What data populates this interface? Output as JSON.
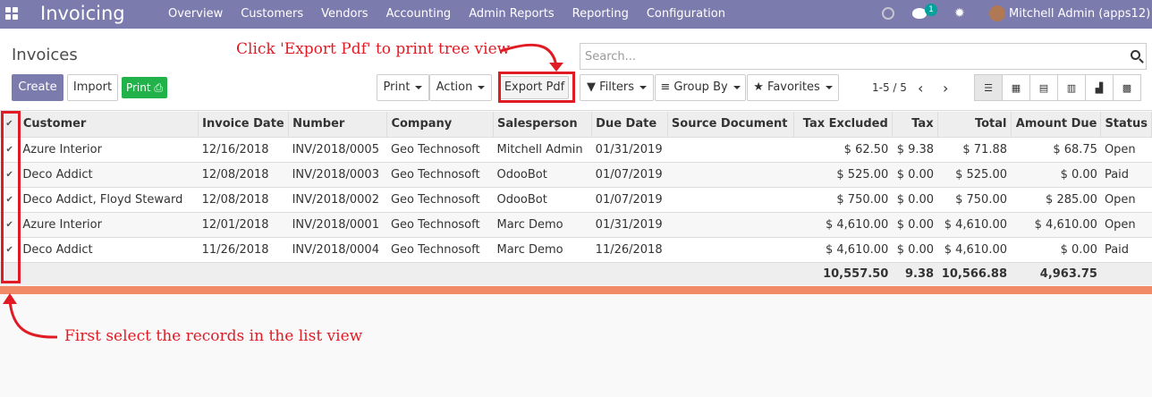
{
  "nav": {
    "brand": "Invoicing",
    "menu": [
      "Overview",
      "Customers",
      "Vendors",
      "Accounting",
      "Admin Reports",
      "Reporting",
      "Configuration"
    ],
    "chat_count": "1",
    "user": "Mitchell Admin (apps12)"
  },
  "control": {
    "breadcrumb": "Invoices",
    "create": "Create",
    "import": "Import",
    "print_green": "Print",
    "print": "Print",
    "action": "Action",
    "export_pdf": "Export Pdf",
    "search_placeholder": "Search...",
    "filters": "Filters",
    "group_by": "Group By",
    "favorites": "Favorites",
    "pager": "1-5 / 5"
  },
  "annotations": {
    "top": "Click 'Export Pdf' to print tree view",
    "bottom": "First select the records in the list view"
  },
  "table": {
    "headers": [
      "Customer",
      "Invoice Date",
      "Number",
      "Company",
      "Salesperson",
      "Due Date",
      "Source Document",
      "Tax Excluded",
      "Tax",
      "Total",
      "Amount Due",
      "Status"
    ],
    "rows": [
      [
        "Azure Interior",
        "12/16/2018",
        "INV/2018/0005",
        "Geo Technosoft",
        "Mitchell Admin",
        "01/31/2019",
        "",
        "$ 62.50",
        "$ 9.38",
        "$ 71.88",
        "$ 68.75",
        "Open"
      ],
      [
        "Deco Addict",
        "12/08/2018",
        "INV/2018/0003",
        "Geo Technosoft",
        "OdooBot",
        "01/07/2019",
        "",
        "$ 525.00",
        "$ 0.00",
        "$ 525.00",
        "$ 0.00",
        "Paid"
      ],
      [
        "Deco Addict, Floyd Steward",
        "12/08/2018",
        "INV/2018/0002",
        "Geo Technosoft",
        "OdooBot",
        "01/07/2019",
        "",
        "$ 750.00",
        "$ 0.00",
        "$ 750.00",
        "$ 285.00",
        "Open"
      ],
      [
        "Azure Interior",
        "12/01/2018",
        "INV/2018/0001",
        "Geo Technosoft",
        "Marc Demo",
        "01/31/2019",
        "",
        "$ 4,610.00",
        "$ 0.00",
        "$ 4,610.00",
        "$ 4,610.00",
        "Open"
      ],
      [
        "Deco Addict",
        "11/26/2018",
        "INV/2018/0004",
        "Geo Technosoft",
        "Marc Demo",
        "11/26/2018",
        "",
        "$ 4,610.00",
        "$ 0.00",
        "$ 4,610.00",
        "$ 0.00",
        "Paid"
      ]
    ],
    "totals": [
      "10,557.50",
      "9.38",
      "10,566.88",
      "4,963.75"
    ]
  },
  "colors": {
    "nav": "#7c7bad",
    "highlight": "#e01b24",
    "accent_bar": "#f08a67"
  }
}
